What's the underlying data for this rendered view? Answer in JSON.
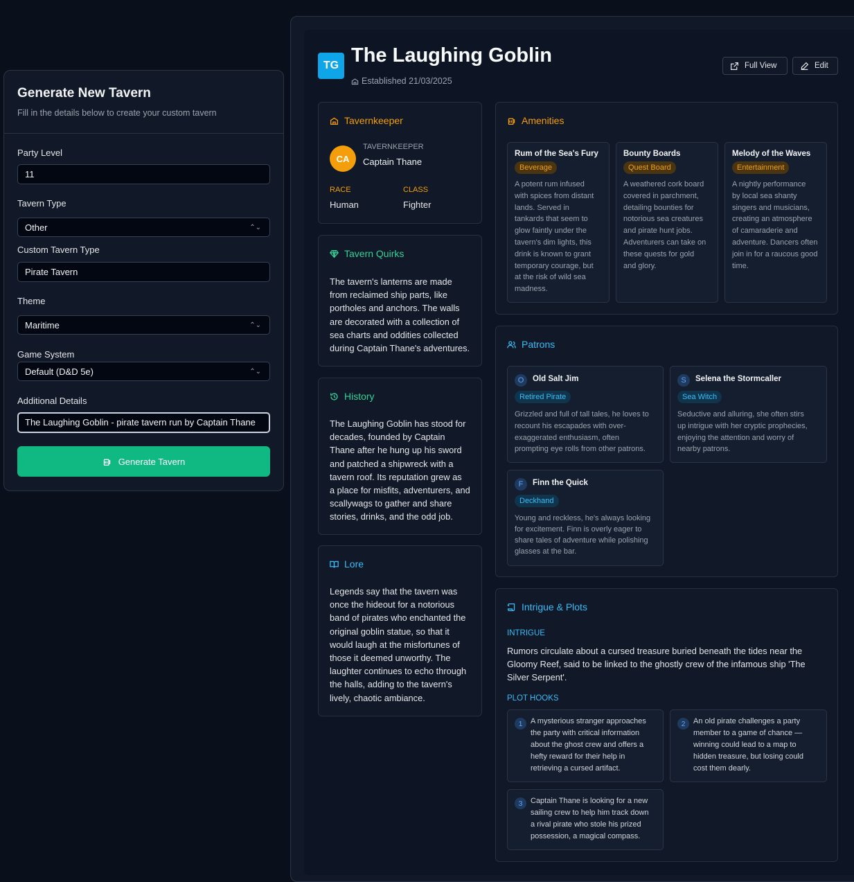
{
  "form": {
    "title": "Generate New Tavern",
    "subtitle": "Fill in the details below to create your custom tavern",
    "party_level_label": "Party Level",
    "party_level_value": "11",
    "tavern_type_label": "Tavern Type",
    "tavern_type_value": "Other",
    "custom_type_label": "Custom Tavern Type",
    "custom_type_value": "Pirate Tavern",
    "theme_label": "Theme",
    "theme_value": "Maritime",
    "game_system_label": "Game System",
    "game_system_value": "Default (D&D 5e)",
    "additional_label": "Additional Details",
    "additional_value": "The Laughing Goblin - pirate tavern run by Captain Thane",
    "generate_label": "Generate Tavern"
  },
  "tavern": {
    "initials": "TG",
    "name": "The Laughing Goblin",
    "established": "Established 21/03/2025",
    "full_view_label": "Full View",
    "edit_label": "Edit"
  },
  "keeper": {
    "title": "Tavernkeeper",
    "initials": "CA",
    "role_label": "TAVERNKEEPER",
    "name": "Captain Thane",
    "race_label": "RACE",
    "race": "Human",
    "class_label": "CLASS",
    "class": "Fighter"
  },
  "quirks": {
    "title": "Tavern Quirks",
    "lines": [
      "The tavern's lanterns are made",
      "from reclaimed ship parts, like",
      "portholes and anchors. The walls",
      "are decorated with a collection of",
      "sea charts and oddities collected",
      "during Captain Thane's adventures."
    ]
  },
  "history": {
    "title": "History",
    "lines": [
      "The Laughing Goblin has stood for",
      "decades, founded by Captain",
      "Thane after he hung up his sword",
      "and patched a shipwreck with a",
      "tavern roof. Its reputation grew as",
      "a place for misfits, adventurers, and",
      "scallywags to gather and share",
      "stories, drinks, and the odd job."
    ]
  },
  "lore": {
    "title": "Lore",
    "lines": [
      "Legends say that the tavern was",
      "once the hideout for a notorious",
      "band of pirates who enchanted the",
      "original goblin statue, so that it",
      "would laugh at the misfortunes of",
      "those it deemed unworthy. The",
      "laughter continues to echo through",
      "the halls, adding to the tavern's",
      "lively, chaotic ambiance."
    ]
  },
  "amenities": {
    "title": "Amenities",
    "items": [
      {
        "name": "Rum of the Sea's Fury",
        "tag": "Beverage",
        "lines": [
          "A potent rum infused",
          "with spices from distant",
          "lands. Served in",
          "tankards that seem to",
          "glow faintly under the",
          "tavern's dim lights, this",
          "drink is known to grant",
          "temporary courage, but",
          "at the risk of wild sea",
          "madness."
        ]
      },
      {
        "name": "Bounty Boards",
        "tag": "Quest Board",
        "lines": [
          "A weathered cork board",
          "covered in parchment,",
          "detailing bounties for",
          "notorious sea creatures",
          "and pirate hunt jobs.",
          "Adventurers can take on",
          "these quests for gold",
          "and glory."
        ]
      },
      {
        "name": "Melody of the Waves",
        "tag": "Entertainment",
        "lines": [
          "A nightly performance",
          "by local sea shanty",
          "singers and musicians,",
          "creating an atmosphere",
          "of camaraderie and",
          "adventure. Dancers often",
          "join in for a raucous good",
          "time."
        ]
      }
    ]
  },
  "patrons": {
    "title": "Patrons",
    "items": [
      {
        "initial": "O",
        "name": "Old Salt Jim",
        "tag": "Retired Pirate",
        "lines": [
          "Grizzled and full of tall tales, he loves to",
          "recount his escapades with over-",
          "exaggerated enthusiasm, often",
          "prompting eye rolls from other patrons."
        ]
      },
      {
        "initial": "S",
        "name": "Selena the Stormcaller",
        "tag": "Sea Witch",
        "lines": [
          "Seductive and alluring, she often stirs",
          "up intrigue with her cryptic prophecies,",
          "enjoying the attention and worry of",
          "nearby patrons."
        ]
      },
      {
        "initial": "F",
        "name": "Finn the Quick",
        "tag": "Deckhand",
        "lines": [
          "Young and reckless, he's always looking",
          "for excitement. Finn is overly eager to",
          "share tales of adventure while polishing",
          "glasses at the bar."
        ]
      }
    ]
  },
  "intrigue": {
    "title": "Intrigue & Plots",
    "intrigue_label": "INTRIGUE",
    "lines": [
      "Rumors circulate about a cursed treasure buried beneath the tides near the",
      "Gloomy Reef, said to be linked to the ghostly crew of the infamous ship 'The",
      "Silver Serpent'."
    ],
    "hooks_label": "PLOT HOOKS",
    "hooks": [
      {
        "num": "1",
        "lines": [
          "A mysterious stranger approaches",
          "the party with critical information",
          "about the ghost crew and offers a",
          "hefty reward for their help in",
          "retrieving a cursed artifact."
        ]
      },
      {
        "num": "2",
        "lines": [
          "An old pirate challenges a party",
          "member to a game of chance —",
          "winning could lead to a map to",
          "hidden treasure, but losing could",
          "cost them dearly."
        ]
      },
      {
        "num": "3",
        "lines": [
          "Captain Thane is looking for a new",
          "sailing crew to help him track down",
          "a rival pirate who stole his prized",
          "possession, a magical compass."
        ]
      }
    ]
  }
}
